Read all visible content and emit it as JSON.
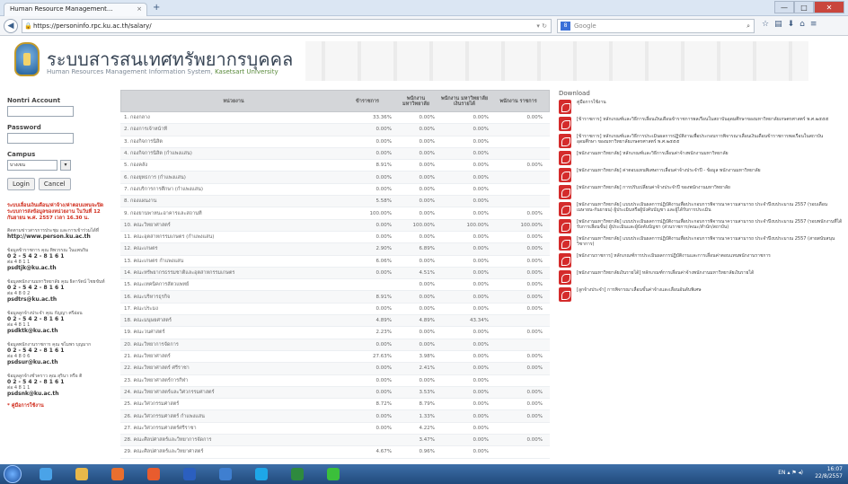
{
  "browser": {
    "tab_title": "Human Resource Management...",
    "tab_close": "×",
    "new_tab": "+",
    "url": "https://personinfo.rpc.ku.ac.th/salary/",
    "search_placeholder": "Google",
    "win_min": "—",
    "win_max": "□",
    "win_close": "✕"
  },
  "header": {
    "title": "ระบบสารสนเทศทรัพยากรบุคคล",
    "subtitle_prefix": "Human Resources Management Information System,",
    "subtitle_uni": "Kasetsart University"
  },
  "login": {
    "account_label": "Nontri Account",
    "password_label": "Password",
    "campus_label": "Campus",
    "campus_value": "บางเขน",
    "login_btn": "Login",
    "cancel_btn": "Cancel"
  },
  "sidebar": {
    "notice": "ระบบเลื่อนเงินเดือน/ค่าจ้าง/ค่าตอบแทนจะปิดระบบการส่งข้อมูลของหน่วยงาน ในวันที่ 12 กันยายน พ.ศ. 2557 เวลา 16.30 น.",
    "info_text": "ติดตามข่าวสารการประชุม และการเข้าร่วมได้ที่",
    "info_url": "http://www.person.ku.ac.th",
    "contacts": [
      {
        "text": "ข้อมูลข้าราชการ คุณ ทิพวรรณ ในแพนริม",
        "phone": "0 2 - 5 4 2 - 8 1 6 1",
        "ext": "ต่อ 4 8 1 1",
        "email": "psdtjk@ku.ac.th"
      },
      {
        "text": "ข้อมูลพนักงานมหาวิทยาลัย คุณ ธิดารัตน์ ไชยขันท์",
        "phone": "0 2 - 5 4 2 - 8 1 6 1",
        "ext": "ต่อ 4 8 0 2",
        "email": "psdtrs@ku.ac.th"
      },
      {
        "text": "ข้อมูลลูกจ้างประจำ คุณ กัญญา ศรีอ่อน",
        "phone": "0 2 - 5 4 2 - 8 1 6 1",
        "ext": "ต่อ 4 8 1 1",
        "email": "psdktk@ku.ac.th"
      },
      {
        "text": "ข้อมูลพนักงานราชการ คุณ ชไมพร บุญมาก",
        "phone": "0 2 - 5 4 2 - 8 1 6 1",
        "ext": "ต่อ 4 8 0 6",
        "email": "psdsur@ku.ac.th"
      },
      {
        "text": "ข้อมูลลูกจ้างชั่วคราว คุณ สุรินา หรือ ติ",
        "phone": "0 2 - 5 4 2 - 8 1 6 1",
        "ext": "ต่อ 4 8 1 1",
        "email": "psdsnk@ku.ac.th"
      }
    ],
    "red_link": "* คู่มือการใช้งาน"
  },
  "table": {
    "headers": [
      "หน่วยงาน",
      "ข้าราชการ",
      "พนักงาน มหาวิทยาลัย",
      "พนักงาน มหาวิทยาลัย เงินรายได้",
      "พนักงาน ราชการ"
    ],
    "rows": [
      [
        "1. กองกลาง",
        "33.36%",
        "0.00%",
        "0.00%",
        "0.00%"
      ],
      [
        "2. กองการเจ้าหน้าที่",
        "0.00%",
        "0.00%",
        "0.00%",
        ""
      ],
      [
        "3. กองกิจการนิสิต",
        "0.00%",
        "0.00%",
        "0.00%",
        ""
      ],
      [
        "4. กองกิจการนิสิต (กำแพงแสน)",
        "0.00%",
        "0.00%",
        "0.00%",
        ""
      ],
      [
        "5. กองคลัง",
        "8.91%",
        "0.00%",
        "0.00%",
        "0.00%"
      ],
      [
        "6. กองยุทธการ (กำแพงแสน)",
        "0.00%",
        "0.00%",
        "0.00%",
        ""
      ],
      [
        "7. กองบริการการศึกษา (กำแพงแสน)",
        "0.00%",
        "0.00%",
        "0.00%",
        ""
      ],
      [
        "8. กองแผนงาน",
        "5.58%",
        "0.00%",
        "0.00%",
        ""
      ],
      [
        "9. กองยานพาหนะอาคารและสถานที่",
        "100.00%",
        "0.00%",
        "0.00%",
        "0.00%"
      ],
      [
        "10. คณะวิทยาศาสตร์",
        "0.00%",
        "100.00%",
        "100.00%",
        "100.00%"
      ],
      [
        "11. คณะอุตสาหกรรมเกษตร (กำแพงแสน)",
        "0.00%",
        "0.00%",
        "0.00%",
        "0.00%"
      ],
      [
        "12. คณะเกษตร",
        "2.90%",
        "6.89%",
        "0.00%",
        "0.00%"
      ],
      [
        "13. คณะเกษตร กำแพงแสน",
        "6.06%",
        "0.00%",
        "0.00%",
        "0.00%"
      ],
      [
        "14. คณะทรัพยากรธรรมชาติและอุตสาหกรรมเกษตร",
        "0.00%",
        "4.51%",
        "0.00%",
        "0.00%"
      ],
      [
        "15. คณะเทคนิคการสัตวแพทย์",
        "",
        "0.00%",
        "0.00%",
        "0.00%"
      ],
      [
        "16. คณะบริหารธุรกิจ",
        "8.91%",
        "0.00%",
        "0.00%",
        "0.00%"
      ],
      [
        "17. คณะประมง",
        "0.00%",
        "0.00%",
        "0.00%",
        "0.00%"
      ],
      [
        "18. คณะมนุษยศาสตร์",
        "4.89%",
        "4.89%",
        "43.34%",
        ""
      ],
      [
        "19. คณะวนศาสตร์",
        "2.23%",
        "0.00%",
        "0.00%",
        "0.00%"
      ],
      [
        "20. คณะวิทยาการจัดการ",
        "0.00%",
        "0.00%",
        "0.00%",
        ""
      ],
      [
        "21. คณะวิทยาศาสตร์",
        "27.63%",
        "3.98%",
        "0.00%",
        "0.00%"
      ],
      [
        "22. คณะวิทยาศาสตร์ ศรีราชา",
        "0.00%",
        "2.41%",
        "0.00%",
        "0.00%"
      ],
      [
        "23. คณะวิทยาศาสตร์การกีฬา",
        "0.00%",
        "0.00%",
        "0.00%",
        ""
      ],
      [
        "24. คณะวิทยาศาสตร์และวิศวกรรมศาสตร์",
        "0.00%",
        "3.53%",
        "0.00%",
        "0.00%"
      ],
      [
        "25. คณะวิศวกรรมศาสตร์",
        "8.72%",
        "8.79%",
        "0.00%",
        "0.00%"
      ],
      [
        "26. คณะวิศวกรรมศาสตร์ กำแพงแสน",
        "0.00%",
        "1.33%",
        "0.00%",
        "0.00%"
      ],
      [
        "27. คณะวิศวกรรมศาสตร์ศรีราชา",
        "0.00%",
        "4.22%",
        "0.00%",
        ""
      ],
      [
        "28. คณะศิลปศาสตร์และวิทยาการจัดการ",
        "",
        "3.47%",
        "0.00%",
        "0.00%"
      ],
      [
        "29. คณะศิลปศาสตร์และวิทยาศาสตร์",
        "4.67%",
        "0.96%",
        "0.00%",
        ""
      ]
    ]
  },
  "downloads": {
    "title": "Download",
    "items": [
      "คู่มือการใช้งาน",
      "[ข้าราชการ] หลักเกณฑ์และวิธีการเลื่อนเงินเดือนข้าราชการพลเรือนในสถาบันอุดมศึกษาของมหาวิทยาลัยเกษตรศาสตร์ พ.ศ.๒๕๕๕",
      "[ข้าราชการ] หลักเกณฑ์และวิธีการประเมินผลการปฏิบัติงานเพื่อประกอบการพิจารณาเลื่อนเงินเดือนข้าราชการพลเรือนในสถาบันอุดมศึกษา ของมหาวิทยาลัยเกษตรศาสตร์ พ.ศ.๒๕๕๕",
      "[พนักงานมหาวิทยาลัย] หลักเกณฑ์และวิธีการเลื่อนค่าจ้างพนักงานมหาวิทยาลัย",
      "[พนักงานมหาวิทยาลัย] ค่าตอบแทนพิเศษการเลื่อนค่าจ้างประจำปี - ข้อมูล พนักงานมหาวิทยาลัย",
      "[พนักงานมหาวิทยาลัย] การปรับเปลี่ยนค่าจ้างประจำปี ของพนักงานมหาวิทยาลัย",
      "[พนักงานมหาวิทยาลัย] แบบประเมินผลการปฏิบัติงานเพื่อประกอบการพิจารณาความสามารถ ประจำปีงบประมาณ 2557 (รอบเดือนเมษายน-กันยายน) ผู้ประเมินหรือผู้บังคับบัญชา และผู้ได้รับการประเมิน",
      "[พนักงานมหาวิทยาลัย] แบบประเมินผลการปฏิบัติงานเพื่อประกอบการพิจารณาความสามารถ ประจำปีงบประมาณ 2557 (รอบพนักงานที่ได้รับการเลื่อนขั้น) ผู้ประเมินและผู้บังคับบัญชา (ส่วนราชการ/คณะ/สำนัก/สถาบัน)",
      "[พนักงานมหาวิทยาลัย] แบบประเมินผลการปฏิบัติงานเพื่อประกอบการพิจารณาความสามารถ ประจำปีงบประมาณ 2557 (สายสนับสนุนวิชาการ)",
      "[พนักงานราชการ] หลักเกณฑ์การประเมินผลการปฏิบัติงานและการเลื่อนค่าตอบแทนพนักงานราชการ",
      "[พนักงานมหาวิทยาลัยเงินรายได้] หลักเกณฑ์การเลื่อนค่าจ้างพนักงานมหาวิทยาลัยเงินรายได้",
      "[ลูกจ้างประจำ] การพิจารณาเลื่อนขั้นค่าจ้างและเลื่อนอันดับพิเศษ"
    ]
  },
  "taskbar": {
    "lang": "EN",
    "time": "16:07",
    "date": "22/8/2557",
    "apps": [
      {
        "name": "taskbar-ie-icon",
        "color": "#4aa3e8"
      },
      {
        "name": "taskbar-folder-icon",
        "color": "#e8b84a"
      },
      {
        "name": "taskbar-media-icon",
        "color": "#e86f2e"
      },
      {
        "name": "taskbar-firefox-icon",
        "color": "#e85c2e"
      },
      {
        "name": "taskbar-word-icon",
        "color": "#2b5fbf"
      },
      {
        "name": "taskbar-outlook-icon",
        "color": "#3f7fd0"
      },
      {
        "name": "taskbar-skype-icon",
        "color": "#1ea7e8"
      },
      {
        "name": "taskbar-excel-icon",
        "color": "#2e8a3e"
      },
      {
        "name": "taskbar-line-icon",
        "color": "#3bbf3b"
      }
    ]
  }
}
